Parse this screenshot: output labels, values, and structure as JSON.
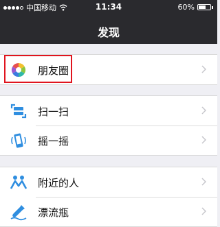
{
  "status_bar": {
    "carrier": "中国移动",
    "time": "11:34",
    "battery_text": "60%",
    "battery_level": 0.6
  },
  "nav": {
    "title": "发现"
  },
  "groups": [
    {
      "items": [
        {
          "label": "朋友圈",
          "icon": "moments-icon"
        }
      ]
    },
    {
      "items": [
        {
          "label": "扫一扫",
          "icon": "scan-icon"
        },
        {
          "label": "摇一摇",
          "icon": "shake-icon"
        }
      ]
    },
    {
      "items": [
        {
          "label": "附近的人",
          "icon": "people-nearby-icon"
        },
        {
          "label": "漂流瓶",
          "icon": "drift-bottle-icon"
        }
      ]
    }
  ],
  "colors": {
    "nav_bg": "#2a2a2e",
    "page_bg": "#efeff4",
    "highlight": "#e0141e",
    "icon_blue": "#2f8ee0"
  }
}
